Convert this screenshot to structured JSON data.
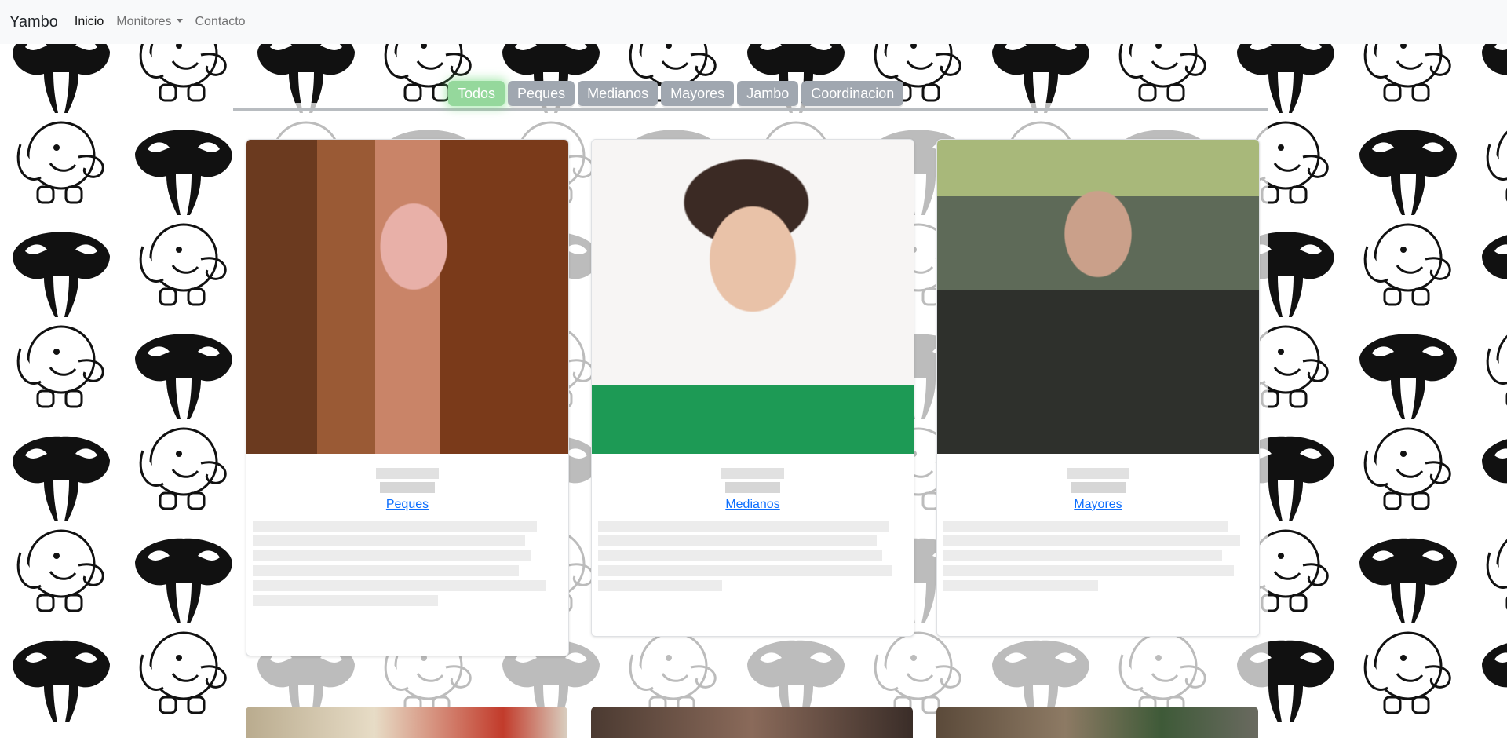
{
  "navbar": {
    "brand": "Yambo",
    "links": [
      {
        "label": "Inicio"
      },
      {
        "label": "Monitores"
      },
      {
        "label": "Contacto"
      }
    ]
  },
  "filters": [
    "Todos",
    "Peques",
    "Medianos",
    "Mayores",
    "Jambo",
    "Coordinacion"
  ],
  "active_filter": "Todos",
  "cards": [
    {
      "group": "Peques"
    },
    {
      "group": "Medianos"
    },
    {
      "group": "Mayores"
    }
  ],
  "colors": {
    "navbar_bg": "#f8f9fa",
    "filter_bg": "#a0a7b0",
    "filter_active_bg": "#95d89c",
    "link": "#0d6efd"
  }
}
